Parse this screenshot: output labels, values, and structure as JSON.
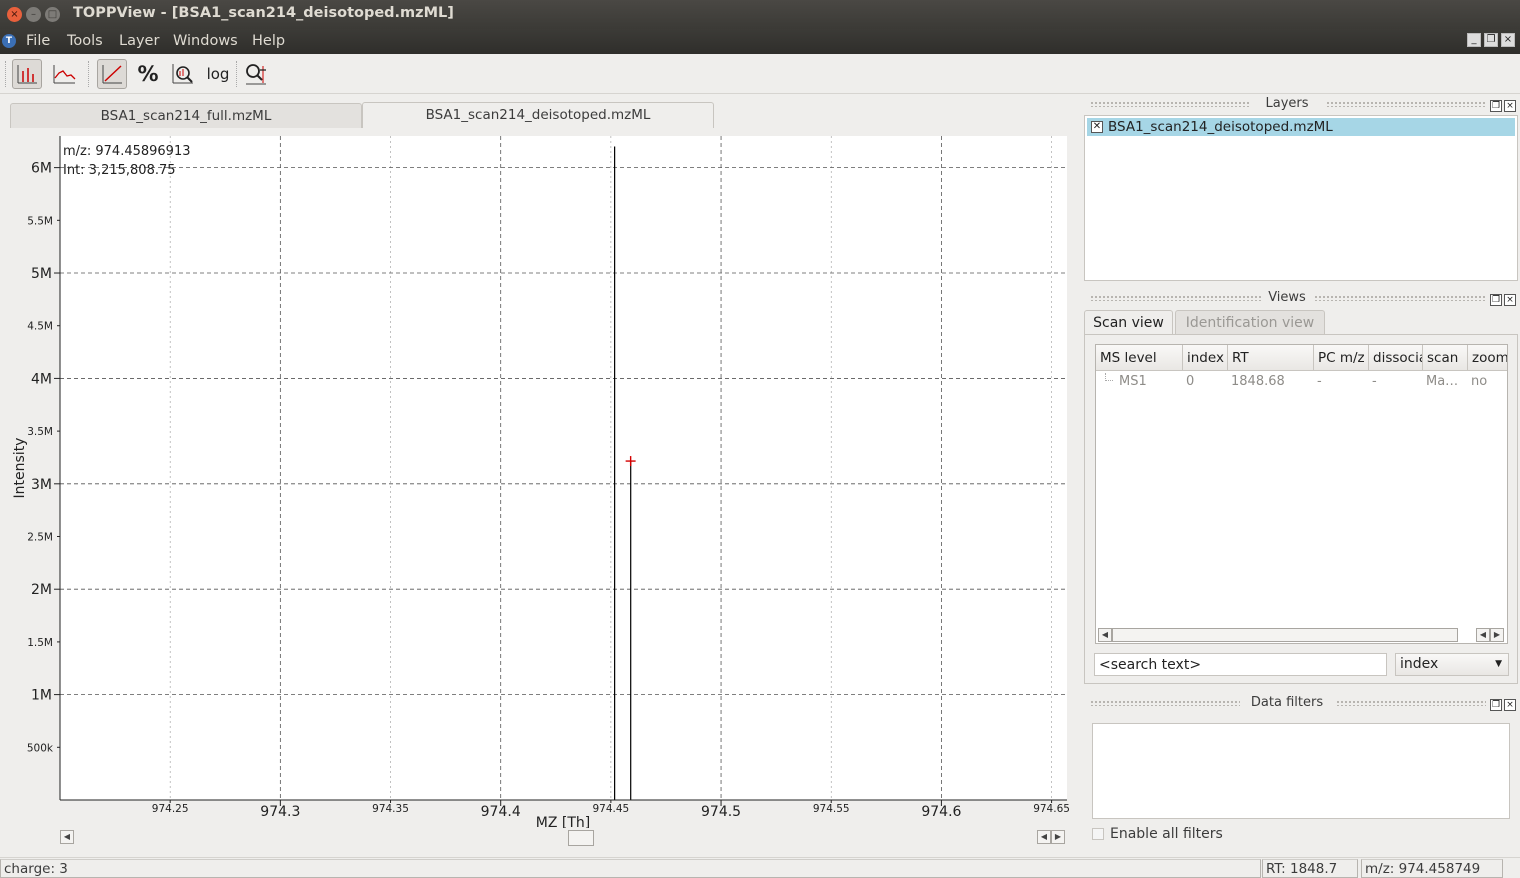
{
  "window": {
    "title": "TOPPView - [BSA1_scan214_deisotoped.mzML]",
    "controls": [
      "close-icon",
      "minimize-icon",
      "maximize-icon"
    ]
  },
  "menubar": {
    "items": [
      "File",
      "Tools",
      "Layer",
      "Windows",
      "Help"
    ]
  },
  "toolbar": {
    "buttons": [
      {
        "icon": "peak-mode-icon",
        "active": true
      },
      {
        "icon": "line-mode-icon",
        "active": false
      },
      {
        "icon": "linear-intensity-icon",
        "active": true
      },
      {
        "icon": "percentage-intensity-icon",
        "label": "%",
        "active": false
      },
      {
        "icon": "snap-intensity-icon",
        "active": false
      },
      {
        "icon": "log-intensity-icon",
        "label": "log",
        "active": false
      },
      {
        "icon": "annotate-icon",
        "active": false
      }
    ]
  },
  "tabs": [
    {
      "label": "BSA1_scan214_full.mzML",
      "active": false
    },
    {
      "label": "BSA1_scan214_deisotoped.mzML",
      "active": true
    }
  ],
  "plot": {
    "cursor_mz_text": "m/z: 974.45896913",
    "cursor_int_text": "Int: 3,215,808.75",
    "xlabel": "MZ [Th]",
    "ylabel": "Intensity"
  },
  "chart_data": {
    "type": "bar",
    "xlabel": "MZ [Th]",
    "ylabel": "Intensity",
    "xlim": [
      974.2,
      974.657
    ],
    "ylim": [
      0,
      6300000
    ],
    "x_major_ticks": [
      {
        "v": 974.3,
        "label": "974.3"
      },
      {
        "v": 974.4,
        "label": "974.4"
      },
      {
        "v": 974.5,
        "label": "974.5"
      },
      {
        "v": 974.6,
        "label": "974.6"
      }
    ],
    "x_minor_ticks": [
      {
        "v": 974.25,
        "label": "974.25"
      },
      {
        "v": 974.35,
        "label": "974.35"
      },
      {
        "v": 974.45,
        "label": "974.45"
      },
      {
        "v": 974.55,
        "label": "974.55"
      },
      {
        "v": 974.65,
        "label": "974.65"
      }
    ],
    "y_major_ticks": [
      {
        "v": 1000000,
        "label": "1M"
      },
      {
        "v": 2000000,
        "label": "2M"
      },
      {
        "v": 3000000,
        "label": "3M"
      },
      {
        "v": 4000000,
        "label": "4M"
      },
      {
        "v": 5000000,
        "label": "5M"
      },
      {
        "v": 6000000,
        "label": "6M"
      }
    ],
    "y_minor_ticks": [
      {
        "v": 500000,
        "label": "500k"
      },
      {
        "v": 1500000,
        "label": "1.5M"
      },
      {
        "v": 2500000,
        "label": "2.5M"
      },
      {
        "v": 3500000,
        "label": "3.5M"
      },
      {
        "v": 4500000,
        "label": "4.5M"
      },
      {
        "v": 5500000,
        "label": "5.5M"
      }
    ],
    "peaks": [
      {
        "mz": 974.4517,
        "intensity": 6200000,
        "color": "#000000"
      },
      {
        "mz": 974.459,
        "intensity": 3215808.75,
        "color": "#000000"
      }
    ],
    "cursor": {
      "mz": 974.45896913,
      "intensity": 3215808.75,
      "color": "#d40000"
    },
    "grid": true
  },
  "layers": {
    "title": "Layers",
    "items": [
      {
        "name": "BSA1_scan214_deisotoped.mzML",
        "checked": true,
        "selected": true
      }
    ]
  },
  "views": {
    "title": "Views",
    "tabs": [
      {
        "label": "Scan view",
        "active": true
      },
      {
        "label": "Identification view",
        "active": false
      }
    ],
    "columns": [
      "MS level",
      "index",
      "RT",
      "PC m/z",
      "dissociation",
      "scan",
      "zoom"
    ],
    "rows": [
      {
        "ms_level": "MS1",
        "index": "0",
        "rt": "1848.68",
        "pc_mz": "-",
        "dissociation": "-",
        "scan": "Ma…",
        "zoom": "no"
      }
    ],
    "search_placeholder": "<search text>",
    "search_field": "index"
  },
  "filters": {
    "title": "Data filters",
    "enable_label": "Enable all filters",
    "enabled": false
  },
  "status": {
    "charge": "charge: 3",
    "rt": "RT:   1848.7",
    "mz": "m/z: 974.458749"
  }
}
